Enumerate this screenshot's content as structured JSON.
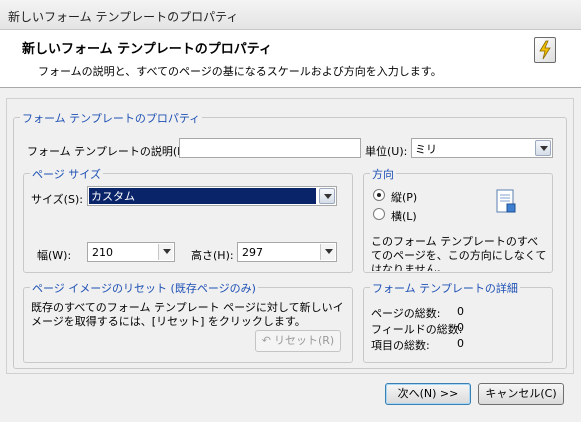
{
  "window": {
    "title": "新しいフォーム テンプレートのプロパティ"
  },
  "header": {
    "title": "新しいフォーム テンプレートのプロパティ",
    "subtitle": "フォームの説明と、すべてのページの基になるスケールおよび方向を入力します。",
    "icon": "wizard-lightning-icon"
  },
  "properties": {
    "legend": "フォーム テンプレートのプロパティ",
    "description_label": "フォーム テンプレートの説明(D):",
    "description_value": "",
    "unit_label": "単位(U):",
    "unit_value": "ミリ"
  },
  "page_size": {
    "legend": "ページ サイズ",
    "size_label": "サイズ(S):",
    "size_value": "カスタム",
    "width_label": "幅(W):",
    "width_value": "210",
    "height_label": "高さ(H):",
    "height_value": "297"
  },
  "orientation": {
    "legend": "方向",
    "portrait_label": "縦(P)",
    "landscape_label": "横(L)",
    "selected": "portrait",
    "note": "このフォーム テンプレートのすべてのページを、この方向にしなくてはなりません。"
  },
  "reset": {
    "legend": "ページ イメージのリセット (既存ページのみ)",
    "text": "既存のすべてのフォーム テンプレート ページに対して新しいイメージを取得するには、[リセット] をクリックします。",
    "button_label": "リセット(R)"
  },
  "details": {
    "legend": "フォーム テンプレートの詳細",
    "pages_label": "ページの総数:",
    "pages_value": "0",
    "fields_label": "フィールドの総数:",
    "fields_value": "0",
    "items_label": "項目の総数:",
    "items_value": "0"
  },
  "footer": {
    "next_label": "次へ(N) >>",
    "cancel_label": "キャンセル(C)"
  }
}
